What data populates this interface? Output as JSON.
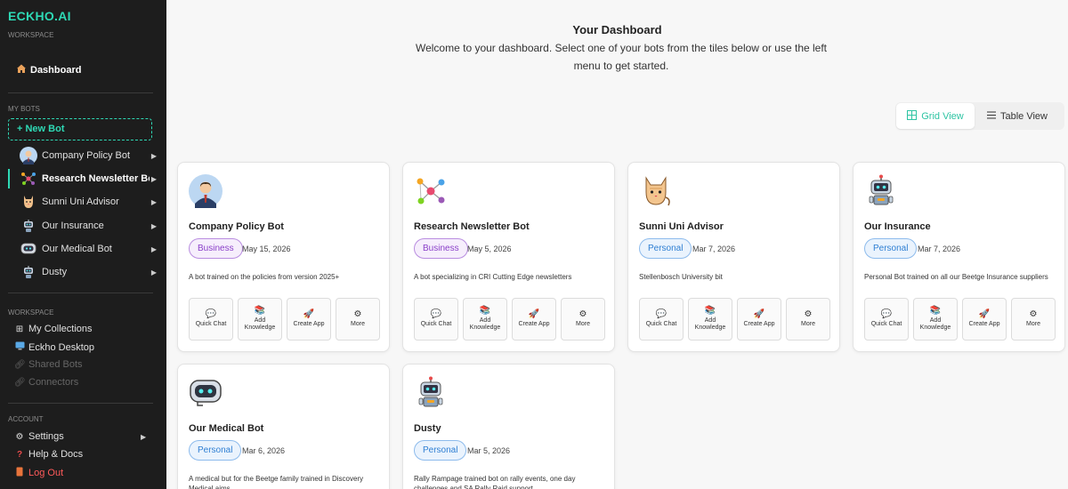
{
  "sidebar": {
    "brand": "ECKHO.AI",
    "workspace_label": "WORKSPACE",
    "dashboard_label": "Dashboard",
    "my_bots_label": "MY BOTS",
    "new_bot_label": "+ New Bot",
    "bots": [
      {
        "label": "Company Policy Bot",
        "icon": "business-man-avatar-icon"
      },
      {
        "label": "Research Newsletter Bo",
        "icon": "network-nodes-icon"
      },
      {
        "label": "Sunni Uni Advisor",
        "icon": "cat-icon"
      },
      {
        "label": "Our Insurance",
        "icon": "robot-icon"
      },
      {
        "label": "Our Medical Bot",
        "icon": "robot-head-icon"
      },
      {
        "label": "Dusty",
        "icon": "robot-icon"
      }
    ],
    "workspace_section_label": "WORKSPACE",
    "workspace_items": [
      {
        "label": "My Collections",
        "icon": "grid-icon"
      },
      {
        "label": "Eckho Desktop",
        "icon": "desktop-icon"
      },
      {
        "label": "Shared Bots",
        "icon": "link-icon"
      },
      {
        "label": "Connectors",
        "icon": "link-icon"
      }
    ],
    "account_label": "ACCOUNT",
    "account_items": [
      {
        "label": "Settings",
        "icon": "gear-icon"
      },
      {
        "label": "Help & Docs",
        "icon": "question-icon"
      },
      {
        "label": "Log Out",
        "icon": "logout-icon"
      }
    ]
  },
  "header": {
    "title": "Your Dashboard",
    "subtitle": "Welcome to your dashboard. Select one of your bots from the tiles below or use the left menu to get started."
  },
  "view_toggle": {
    "grid_label": "Grid View",
    "table_label": "Table View",
    "selected": "grid"
  },
  "cards": [
    {
      "name": "Company Policy Bot",
      "type": "Business",
      "date": "May 15, 2026",
      "description": "A bot trained on the policies from version 2025+"
    },
    {
      "name": "Research Newsletter Bot",
      "type": "Business",
      "date": "May 5, 2026",
      "description": "A bot specializing in CRI Cutting Edge newsletters"
    },
    {
      "name": "Sunni Uni Advisor",
      "type": "Personal",
      "date": "Mar 7, 2026",
      "description": "Stellenbosch University bit"
    },
    {
      "name": "Our Insurance",
      "type": "Personal",
      "date": "Mar 7, 2026",
      "description": "Personal Bot trained on all our Beetge Insurance suppliers"
    },
    {
      "name": "Our Medical Bot",
      "type": "Personal",
      "date": "Mar 6, 2026",
      "description": "A medical but for the Beetge family trained in Discovery Medical aims"
    },
    {
      "name": "Dusty",
      "type": "Personal",
      "date": "Mar 5, 2026",
      "description": "Rally Rampage trained bot on rally events, one day challenges and SA Rally Raid support"
    }
  ],
  "actions": {
    "quick_chat": "Quick Chat",
    "add_knowledge": "Add Knowledge",
    "create_app": "Create App",
    "more": "More"
  },
  "colors": {
    "accent": "#2ed9b5",
    "sidebar_bg": "#1d1d1d",
    "business_badge": "#8a3fc9",
    "personal_badge": "#2f7fd3",
    "logout": "#ff5a5a"
  }
}
